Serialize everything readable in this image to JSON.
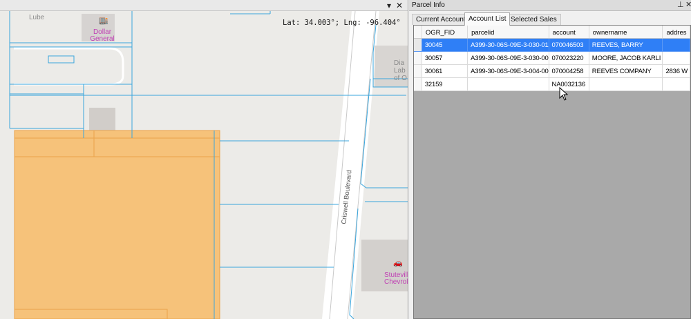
{
  "map": {
    "coord_readout": "Lat: 34.003°; Lng: -96.404°",
    "labels": {
      "lube": "Lube",
      "dollar_general_1": "Dollar",
      "dollar_general_2": "General",
      "criswell": "Criswell Boulevard",
      "diag_1": "Dia",
      "diag_2": "Lab",
      "diag_3": "of O",
      "stuteville_1": "Stutevill",
      "stuteville_2": "Chevrole"
    },
    "colors": {
      "parcel_line": "#3aa6dd",
      "selected_parcel_fill": "#f6c27a",
      "selected_parcel_stroke": "#eba34a",
      "poi": "#c040b4"
    }
  },
  "panel": {
    "title": "Parcel Info",
    "tabs": [
      {
        "label": "Current Account",
        "active": false
      },
      {
        "label": "Account List",
        "active": true
      },
      {
        "label": "Selected Sales",
        "active": false
      }
    ],
    "columns": [
      "OGR_FID",
      "parcelid",
      "account",
      "ownername",
      "addres"
    ],
    "rows": [
      {
        "selected": true,
        "cells": [
          "30045",
          "A399-30-06S-09E-3-030-01",
          "070046503",
          "REEVES, BARRY",
          ""
        ]
      },
      {
        "selected": false,
        "cells": [
          "30057",
          "A399-30-06S-09E-3-030-00",
          "070023220",
          "MOORE, JACOB  KARLI",
          ""
        ]
      },
      {
        "selected": false,
        "cells": [
          "30061",
          "A399-30-06S-09E-3-004-00",
          "070004258",
          "REEVES COMPANY",
          "2836 W"
        ]
      },
      {
        "selected": false,
        "cells": [
          "32159",
          "",
          "NA0032136",
          "",
          ""
        ]
      }
    ],
    "selection_color": "#2f7ff6"
  },
  "icons": {
    "pin": "pin-icon",
    "close": "close-icon",
    "dropdown": "chevron-down-icon",
    "store": "store-icon",
    "car": "car-icon"
  }
}
